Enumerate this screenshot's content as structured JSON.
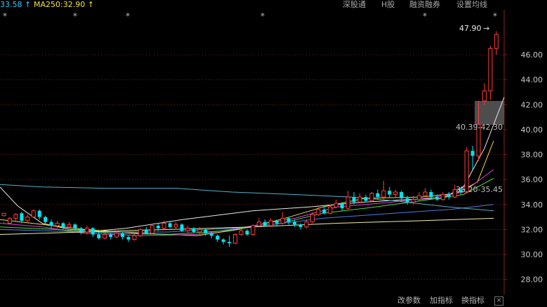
{
  "top_bar": {
    "ma_a": {
      "label": "33.58 ↑",
      "color": "#2ec7ff"
    },
    "ma_b": {
      "label": "MA250:32.90 ↑",
      "color": "#f0e040"
    },
    "menu": [
      "深股通",
      "H股",
      "融资融券",
      "设置均线"
    ]
  },
  "bottom_bar": {
    "buttons": [
      "改参数",
      "加指标",
      "换指标"
    ],
    "close_label": "×"
  },
  "colors": {
    "up": "#ff3e3e",
    "down": "#00e5f0",
    "axis_text": "#c8c8c8",
    "grid": "#7a2020",
    "white_line": "#e8e8e8",
    "yellow_line": "#f4e040",
    "magenta_line": "#e040e0",
    "green_line": "#40e040",
    "blue_line": "#4a7fe0",
    "cyan_ma250": "#4fb3c8",
    "pale_yellow_line": "#f2f2a0"
  },
  "chart_data": {
    "type": "candlestick",
    "y_axis": {
      "ticks": [
        "46.00",
        "44.00",
        "42.00",
        "40.00",
        "38.00",
        "36.00",
        "34.00",
        "32.00",
        "30.00",
        "28.00"
      ],
      "range": [
        26.8,
        48.7
      ]
    },
    "annotations": {
      "high_label": "47.90",
      "high_arrow": "→",
      "range_label_1": "40.39-42.30",
      "range_label_2": "35.20-35.45",
      "gap_zone": [
        40.39,
        42.3
      ]
    },
    "star_markers": [
      "*",
      "*",
      "*",
      "*",
      "*",
      "*"
    ],
    "candles": [
      [
        33.1,
        33.3,
        32.6,
        32.5
      ],
      [
        32.5,
        32.9,
        33.0,
        32.4
      ],
      [
        32.9,
        33.2,
        33.3,
        32.6
      ],
      [
        33.3,
        32.7,
        33.4,
        32.5
      ],
      [
        32.7,
        33.0,
        33.2,
        32.6
      ],
      [
        33.0,
        33.5,
        33.6,
        32.9
      ],
      [
        33.5,
        33.0,
        33.6,
        32.8
      ],
      [
        33.0,
        32.6,
        33.1,
        32.4
      ],
      [
        32.6,
        32.3,
        32.8,
        32.1
      ],
      [
        32.3,
        32.5,
        32.7,
        32.1
      ],
      [
        32.5,
        32.2,
        32.6,
        32.0
      ],
      [
        32.2,
        32.4,
        32.6,
        32.0
      ],
      [
        32.4,
        32.1,
        32.5,
        31.9
      ],
      [
        32.1,
        31.8,
        32.2,
        31.6
      ],
      [
        31.8,
        32.1,
        32.3,
        31.6
      ],
      [
        32.1,
        31.6,
        32.2,
        31.4
      ],
      [
        31.6,
        31.3,
        31.8,
        31.2
      ],
      [
        31.3,
        31.6,
        31.7,
        31.2
      ],
      [
        31.6,
        31.4,
        31.7,
        31.2
      ],
      [
        31.4,
        31.7,
        31.9,
        31.3
      ],
      [
        31.7,
        31.4,
        31.8,
        31.2
      ],
      [
        31.4,
        31.2,
        31.5,
        31.0
      ],
      [
        31.2,
        31.5,
        31.7,
        31.1
      ],
      [
        31.5,
        32.0,
        32.1,
        31.4
      ],
      [
        32.0,
        31.7,
        32.2,
        31.6
      ],
      [
        31.7,
        32.3,
        32.4,
        31.6
      ],
      [
        32.3,
        32.1,
        32.5,
        31.9
      ],
      [
        32.1,
        32.5,
        32.7,
        32.0
      ],
      [
        32.5,
        32.2,
        32.7,
        32.1
      ],
      [
        32.2,
        32.4,
        32.6,
        32.0
      ],
      [
        32.4,
        31.9,
        32.5,
        31.8
      ],
      [
        31.9,
        32.1,
        32.3,
        31.7
      ],
      [
        32.1,
        31.8,
        32.2,
        31.7
      ],
      [
        31.8,
        32.0,
        32.2,
        31.6
      ],
      [
        32.0,
        31.7,
        32.1,
        31.5
      ],
      [
        31.7,
        31.5,
        31.8,
        31.3
      ],
      [
        31.5,
        31.2,
        31.6,
        31.0
      ],
      [
        31.2,
        31.0,
        31.3,
        30.8
      ],
      [
        31.0,
        30.9,
        31.5,
        30.6
      ],
      [
        30.9,
        31.6,
        31.7,
        30.8
      ],
      [
        31.6,
        31.9,
        32.0,
        31.5
      ],
      [
        31.9,
        31.6,
        32.0,
        31.5
      ],
      [
        31.6,
        32.3,
        32.4,
        31.5
      ],
      [
        32.3,
        32.6,
        32.9,
        32.2
      ],
      [
        32.6,
        32.3,
        32.8,
        32.2
      ],
      [
        32.3,
        32.7,
        32.9,
        32.2
      ],
      [
        32.7,
        32.5,
        32.8,
        32.3
      ],
      [
        32.5,
        32.9,
        33.4,
        32.4
      ],
      [
        32.9,
        32.6,
        33.0,
        32.4
      ],
      [
        32.6,
        32.4,
        32.8,
        32.2
      ],
      [
        32.4,
        32.2,
        32.5,
        32.0
      ],
      [
        32.2,
        32.6,
        32.8,
        32.1
      ],
      [
        32.6,
        33.2,
        33.4,
        32.5
      ],
      [
        33.2,
        33.6,
        33.8,
        33.1
      ],
      [
        33.6,
        33.3,
        33.9,
        33.2
      ],
      [
        33.3,
        33.8,
        34.0,
        33.2
      ],
      [
        33.8,
        34.1,
        34.4,
        33.7
      ],
      [
        34.1,
        33.7,
        34.2,
        33.5
      ],
      [
        33.7,
        34.6,
        35.1,
        33.6
      ],
      [
        34.6,
        34.2,
        35.0,
        34.0
      ],
      [
        34.2,
        34.6,
        34.9,
        34.1
      ],
      [
        34.6,
        34.3,
        34.8,
        34.2
      ],
      [
        34.3,
        34.9,
        35.0,
        34.2
      ],
      [
        34.9,
        34.6,
        35.2,
        34.4
      ],
      [
        34.6,
        35.1,
        35.9,
        34.4
      ],
      [
        35.1,
        34.8,
        35.4,
        34.5
      ],
      [
        34.8,
        35.0,
        35.2,
        34.6
      ],
      [
        35.0,
        34.5,
        35.1,
        34.3
      ],
      [
        34.5,
        34.2,
        34.7,
        34.0
      ],
      [
        34.2,
        34.4,
        34.7,
        34.0
      ],
      [
        34.4,
        34.7,
        35.0,
        34.3
      ],
      [
        34.7,
        35.0,
        35.3,
        34.6
      ],
      [
        35.0,
        34.6,
        35.2,
        34.4
      ],
      [
        34.6,
        34.4,
        34.8,
        34.3
      ],
      [
        34.4,
        34.8,
        35.0,
        34.3
      ],
      [
        34.8,
        34.6,
        35.0,
        34.4
      ],
      [
        34.6,
        35.2,
        35.6,
        34.5
      ],
      [
        35.2,
        35.0,
        35.4,
        34.8
      ],
      [
        35.0,
        38.3,
        38.6,
        34.9
      ],
      [
        38.3,
        37.9,
        38.7,
        36.8
      ],
      [
        37.9,
        40.4,
        42.3,
        37.5
      ],
      [
        42.3,
        43.1,
        43.7,
        42.0
      ],
      [
        43.1,
        46.5,
        46.7,
        42.4
      ],
      [
        46.5,
        47.6,
        47.9,
        46.0
      ]
    ],
    "ma_lines": {
      "white": [
        [
          0,
          35.4
        ],
        [
          25,
          33.9
        ],
        [
          60,
          32.5
        ],
        [
          100,
          32.0
        ],
        [
          140,
          31.9
        ],
        [
          180,
          32.1
        ],
        [
          260,
          32.8
        ],
        [
          360,
          33.5
        ],
        [
          440,
          33.8
        ],
        [
          520,
          34.2
        ],
        [
          580,
          34.4
        ],
        [
          630,
          34.5
        ],
        [
          660,
          35.4
        ],
        [
          690,
          38.5
        ],
        [
          718,
          42.6
        ]
      ],
      "yellow": [
        [
          0,
          32.8
        ],
        [
          60,
          32.4
        ],
        [
          120,
          32.0
        ],
        [
          200,
          31.7
        ],
        [
          280,
          31.5
        ],
        [
          340,
          32.0
        ],
        [
          400,
          32.8
        ],
        [
          460,
          33.8
        ],
        [
          520,
          34.5
        ],
        [
          600,
          34.6
        ],
        [
          650,
          34.9
        ],
        [
          680,
          35.8
        ],
        [
          703,
          39.1
        ]
      ],
      "magenta": [
        [
          0,
          32.5
        ],
        [
          60,
          32.2
        ],
        [
          120,
          31.7
        ],
        [
          200,
          31.5
        ],
        [
          280,
          31.6
        ],
        [
          340,
          32.1
        ],
        [
          420,
          32.9
        ],
        [
          480,
          33.8
        ],
        [
          560,
          34.2
        ],
        [
          620,
          34.6
        ],
        [
          660,
          35.0
        ],
        [
          703,
          36.8
        ]
      ],
      "green": [
        [
          0,
          32.2
        ],
        [
          80,
          32.0
        ],
        [
          160,
          31.7
        ],
        [
          240,
          31.6
        ],
        [
          320,
          31.9
        ],
        [
          400,
          32.5
        ],
        [
          460,
          33.3
        ],
        [
          520,
          33.7
        ],
        [
          600,
          34.3
        ],
        [
          660,
          34.8
        ],
        [
          703,
          36.1
        ]
      ],
      "blue": [
        [
          0,
          32.0
        ],
        [
          120,
          31.8
        ],
        [
          240,
          31.8
        ],
        [
          360,
          32.2
        ],
        [
          460,
          32.9
        ],
        [
          560,
          33.3
        ],
        [
          640,
          33.6
        ],
        [
          703,
          34.0
        ]
      ],
      "cyan_ma250": [
        [
          0,
          35.6
        ],
        [
          60,
          35.4
        ],
        [
          150,
          35.3
        ],
        [
          250,
          35.3
        ],
        [
          330,
          35.0
        ],
        [
          420,
          34.8
        ],
        [
          500,
          34.6
        ],
        [
          560,
          34.3
        ],
        [
          640,
          33.8
        ],
        [
          703,
          33.5
        ]
      ],
      "pale_yellow": [
        [
          0,
          31.6
        ],
        [
          120,
          31.8
        ],
        [
          240,
          32.0
        ],
        [
          360,
          32.2
        ],
        [
          480,
          32.5
        ],
        [
          600,
          32.7
        ],
        [
          703,
          32.9
        ]
      ]
    }
  }
}
